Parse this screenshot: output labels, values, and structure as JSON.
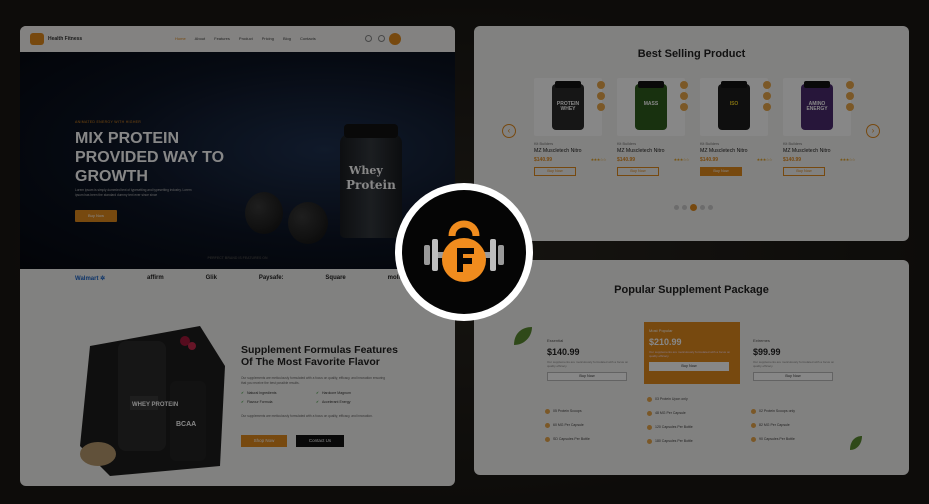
{
  "left": {
    "nav": {
      "brand": "Health Fitness",
      "links": [
        "Home",
        "About",
        "Features",
        "Product",
        "Pricing",
        "Blog",
        "Contacts"
      ]
    },
    "hero": {
      "kicker": "ANIMATED ENERGY WITH HIGHER",
      "title": "MIX PROTEIN PROVIDED WAY TO GROWTH",
      "desc": "Lorem ipsum is simply dummied text of typesetting and typesetting industry. Lorem ipsum has been the standard dummy text ever since since",
      "button": "Buy Now",
      "tub_line1": "Whey",
      "tub_line2": "Protein"
    },
    "brands": {
      "label": "PERFECT BRAND IS FEATURES ON",
      "items": [
        "Walmart ✲",
        "affirm",
        "Glik",
        "Paysafe:",
        "Square",
        "mollie"
      ]
    },
    "features": {
      "title": "Supplement Formulas Features Of The Most Favorite Flavor",
      "desc": "Our supplements are meticulously formulated with a focus on quality, efficacy, and innovation ensuring that you receive the best possible results.",
      "checks": [
        "Natural Ingredients",
        "Hardcore Magnum",
        "Flavour Formula",
        "Accelerant Energy"
      ],
      "desc2": "Our supplements are meticulously formulated with a focus on quality, efficacy, and innovation.",
      "btn_primary": "Shop Now",
      "btn_secondary": "Contact Us",
      "tub_label": "WHEY PROTEIN",
      "tub2_label": "BCAA"
    }
  },
  "best": {
    "title": "Best Selling Product",
    "products": [
      {
        "brand": "Kit Builders",
        "name": "MZ Muscletech Nitro",
        "price": "$140.99",
        "label": "PROTEIN WHEY",
        "color": "#2a2a2a",
        "button": "Buy Now",
        "stars": "★★★☆☆"
      },
      {
        "brand": "Kit Builders",
        "name": "MZ Muscletech Nitro",
        "price": "$140.99",
        "label": "MASS",
        "color": "#2e5d1d",
        "button": "Buy Now",
        "stars": "★★★☆☆"
      },
      {
        "brand": "Kit Builders",
        "name": "MZ Muscletech Nitro",
        "price": "$140.99",
        "label": "ISO",
        "color": "#1e1e1e",
        "button": "Buy Now",
        "stars": "★★★☆☆"
      },
      {
        "brand": "Kit Builders",
        "name": "MZ Muscletech Nitro",
        "price": "$140.99",
        "label": "AMINO ENERGY",
        "color": "#4b2a6e",
        "button": "Buy Now",
        "stars": "★★★☆☆"
      }
    ]
  },
  "packages": {
    "title": "Popular Supplement Package",
    "items": [
      {
        "name": "Essential",
        "price": "$140.99",
        "desc": "Our supplements are meticulously formulated with a focus on quality efficacy.",
        "button": "Buy Now",
        "features": [
          "05 Protein Scoops",
          "60 MG Per Capsule",
          "SD Capsules Per Bottle"
        ]
      },
      {
        "name": "Most Popular",
        "price": "$210.99",
        "desc": "Our supplements are meticulously formulated with a focus on quality efficacy.",
        "button": "Buy Now",
        "features": [
          "03 Protein Upon only",
          "48 MG Per Capsule",
          "120 Capsules Per Bottle",
          "180 Capsules Per Bottle"
        ]
      },
      {
        "name": "Extremes",
        "price": "$99.99",
        "desc": "Our supplements are meticulously formulated with a focus on quality efficacy.",
        "button": "Buy Now",
        "features": [
          "02 Protein Scoops only",
          "82 MG Per Capsule",
          "90 Capsules Per Bottle"
        ]
      }
    ]
  },
  "colors": {
    "accent": "#e08a1e",
    "badge_bg": "#050505",
    "badge_ring": "#ffffff"
  },
  "badge_icon": "kettlebell-f-logo-icon"
}
